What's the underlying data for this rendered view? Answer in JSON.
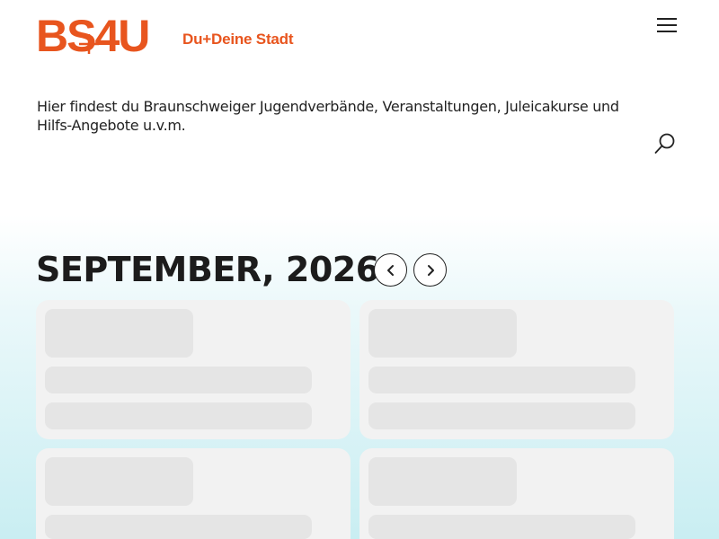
{
  "header": {
    "logo_text": "BS4U",
    "tagline": "Du+Deine Stadt",
    "menu_icon": "hamburger-menu-icon",
    "search_icon": "search-icon"
  },
  "intro_text": "Hier findest du Braunschweiger Jugendverbände, Veranstaltungen, Juleicakurse und Hilfs-Angebote u.v.m.",
  "calendar": {
    "month_label": "SEPTEMBER, 2026",
    "prev_icon": "chevron-left-icon",
    "next_icon": "chevron-right-icon"
  },
  "colors": {
    "brand": "#e8551e",
    "text": "#1c1c1c",
    "skeleton_card": "#f2f2f2",
    "skeleton_block": "#e5e5e5",
    "gradient_bottom": "#c9eef2"
  },
  "event_cards": [
    {
      "state": "loading"
    },
    {
      "state": "loading"
    },
    {
      "state": "loading"
    },
    {
      "state": "loading"
    }
  ]
}
